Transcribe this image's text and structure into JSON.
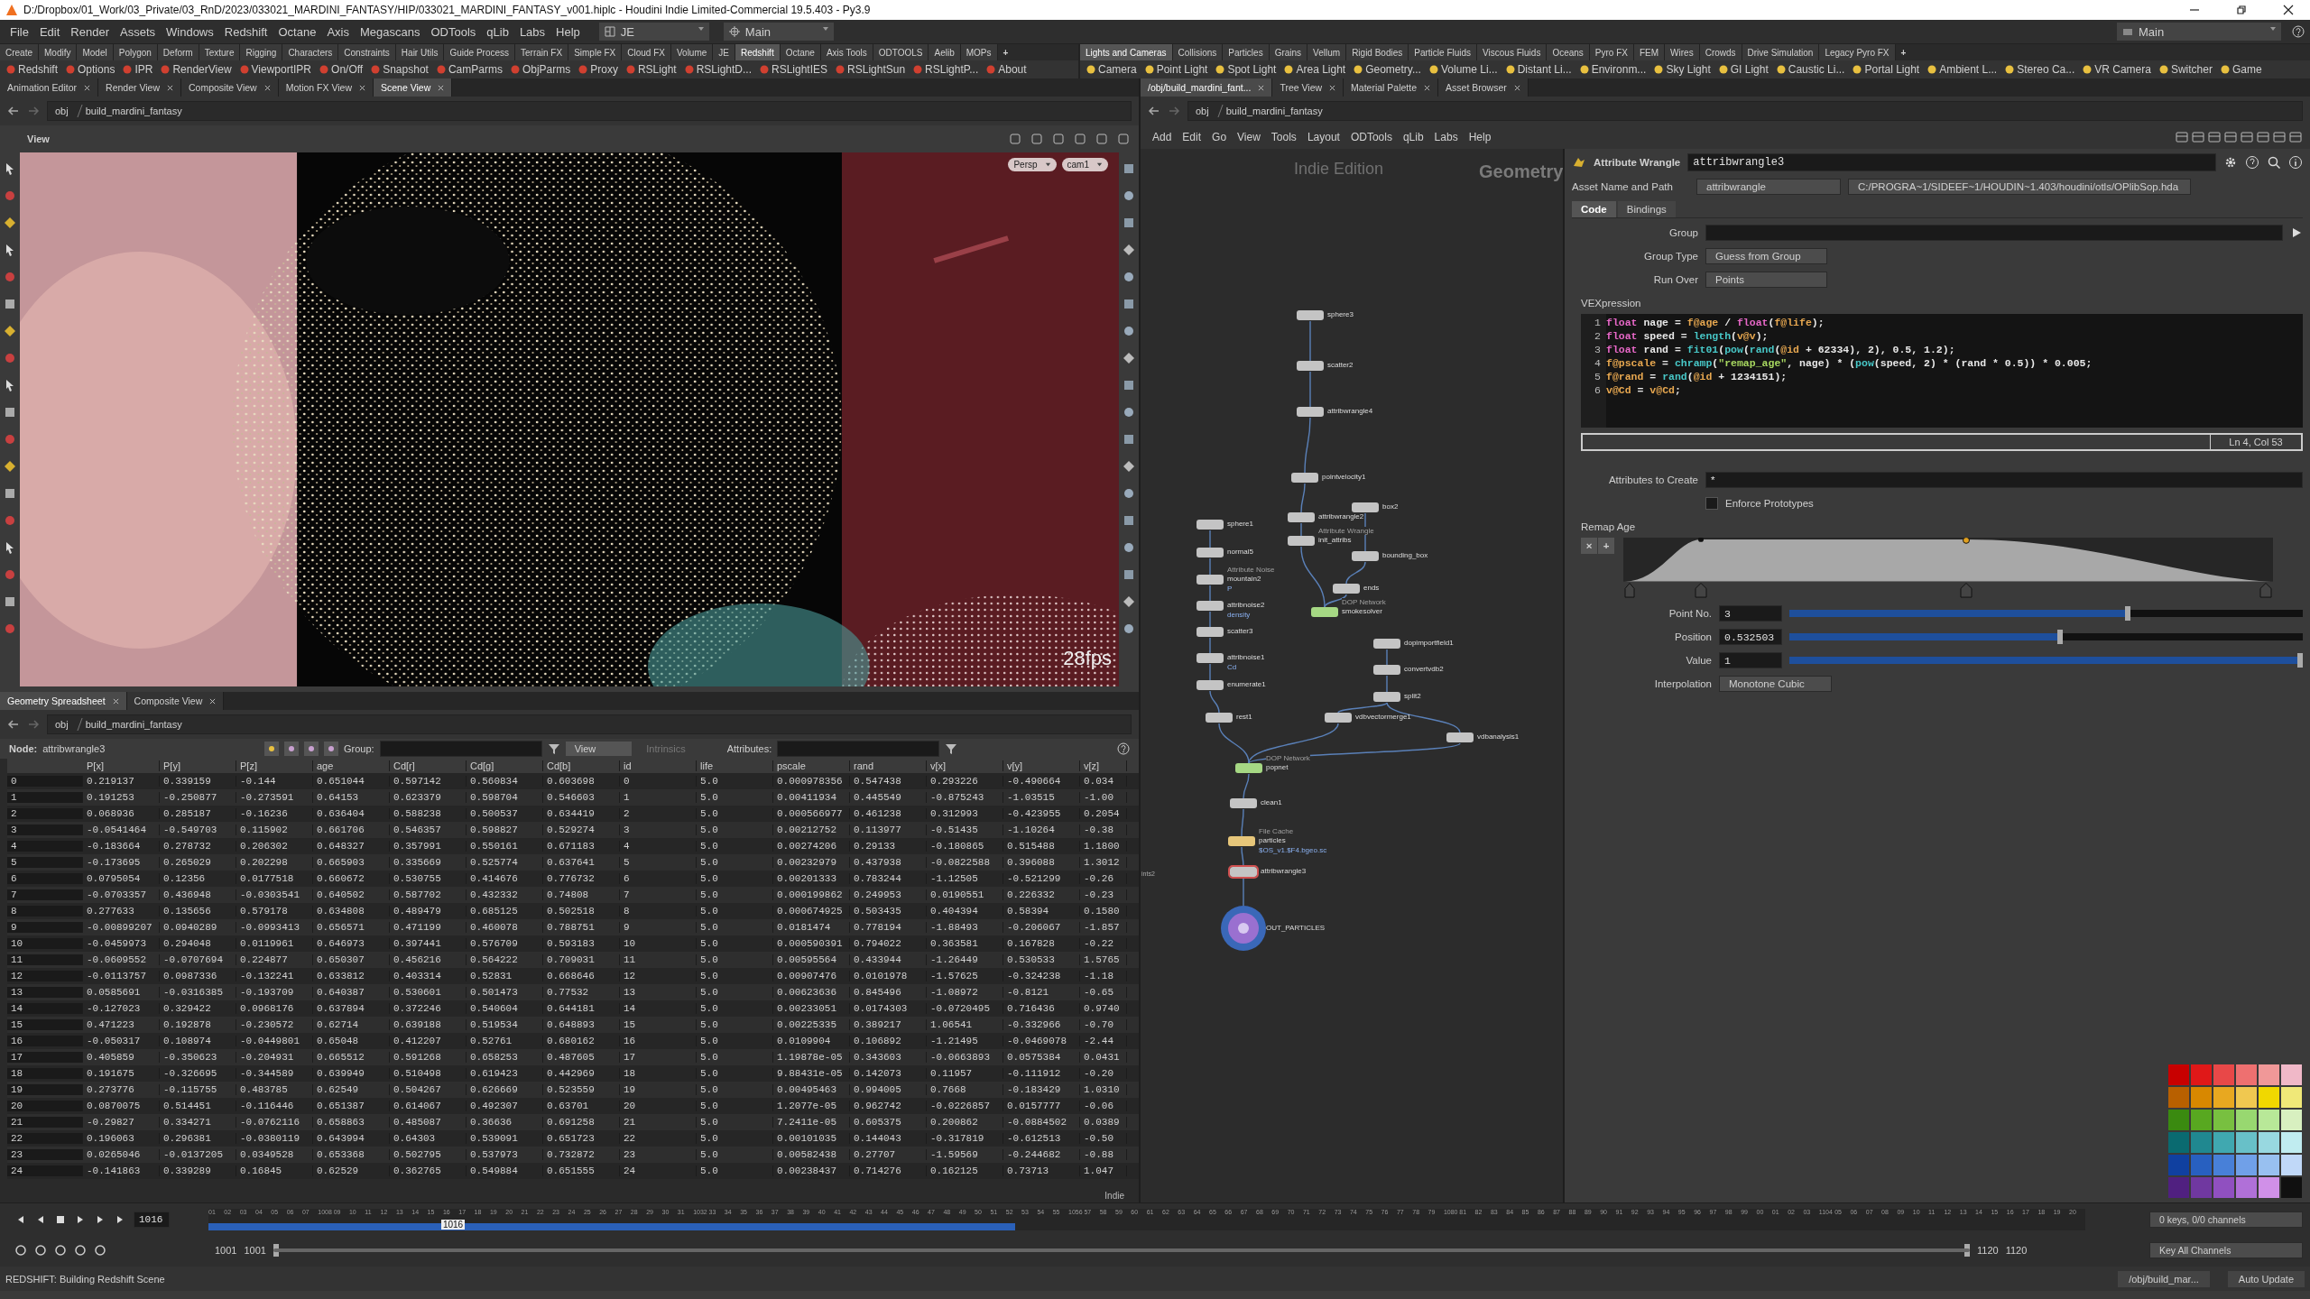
{
  "window": {
    "title": "D:/Dropbox/01_Work/03_Private/03_RnD/2023/033021_MARDINI_FANTASY/HIP/033021_MARDINI_FANTASY_v001.hiplc - Houdini Indie Limited-Commercial 19.5.403 - Py3.9"
  },
  "menu": [
    "File",
    "Edit",
    "Render",
    "Assets",
    "Windows",
    "Redshift",
    "Octane",
    "Axis",
    "Megascans",
    "ODTools",
    "qLib",
    "Labs",
    "Help"
  ],
  "desktop": "JE",
  "context": "Main",
  "desktop_right": "Main",
  "shelf_left": {
    "tabs": [
      {
        "label": "Create",
        "selected": false
      },
      {
        "label": "Modify",
        "selected": false
      },
      {
        "label": "Model",
        "selected": false
      },
      {
        "label": "Polygon",
        "selected": false
      },
      {
        "label": "Deform",
        "selected": false
      },
      {
        "label": "Texture",
        "selected": false
      },
      {
        "label": "Rigging",
        "selected": false
      },
      {
        "label": "Characters",
        "selected": false
      },
      {
        "label": "Constraints",
        "selected": false
      },
      {
        "label": "Hair Utils",
        "selected": false
      },
      {
        "label": "Guide Process",
        "selected": false
      },
      {
        "label": "Terrain FX",
        "selected": false
      },
      {
        "label": "Simple FX",
        "selected": false
      },
      {
        "label": "Cloud FX",
        "selected": false
      },
      {
        "label": "Volume",
        "selected": false
      },
      {
        "label": "JE",
        "selected": false
      },
      {
        "label": "Redshift",
        "selected": true
      },
      {
        "label": "Octane",
        "selected": false
      },
      {
        "label": "Axis Tools",
        "selected": false
      },
      {
        "label": "ODTOOLS",
        "selected": false
      },
      {
        "label": "Aelib",
        "selected": false
      },
      {
        "label": "MOPs",
        "selected": false
      }
    ],
    "add": "+",
    "tools": [
      "Redshift",
      "Options",
      "IPR",
      "RenderView",
      "ViewportIPR",
      "On/Off",
      "Snapshot",
      "CamParms",
      "ObjParms",
      "Proxy",
      "RSLight",
      "RSLightD...",
      "RSLightIES",
      "RSLightSun",
      "RSLightP...",
      "About"
    ]
  },
  "shelf_right": {
    "tabs": [
      {
        "label": "Lights and Cameras",
        "selected": true
      },
      {
        "label": "Collisions",
        "selected": false
      },
      {
        "label": "Particles",
        "selected": false
      },
      {
        "label": "Grains",
        "selected": false
      },
      {
        "label": "Vellum",
        "selected": false
      },
      {
        "label": "Rigid Bodies",
        "selected": false
      },
      {
        "label": "Particle Fluids",
        "selected": false
      },
      {
        "label": "Viscous Fluids",
        "selected": false
      },
      {
        "label": "Oceans",
        "selected": false
      },
      {
        "label": "Pyro FX",
        "selected": false
      },
      {
        "label": "FEM",
        "selected": false
      },
      {
        "label": "Wires",
        "selected": false
      },
      {
        "label": "Crowds",
        "selected": false
      },
      {
        "label": "Drive Simulation",
        "selected": false
      },
      {
        "label": "Legacy Pyro FX",
        "selected": false
      }
    ],
    "add": "+",
    "tools": [
      "Camera",
      "Point Light",
      "Spot Light",
      "Area Light",
      "Geometry...",
      "Volume Li...",
      "Distant Li...",
      "Environm...",
      "Sky Light",
      "GI Light",
      "Caustic Li...",
      "Portal Light",
      "Ambient L...",
      "Stereo Ca...",
      "VR Camera",
      "Switcher",
      "Game"
    ]
  },
  "left_pane": {
    "tabs": [
      {
        "label": "Animation Editor",
        "selected": false
      },
      {
        "label": "Render View",
        "selected": false
      },
      {
        "label": "Composite View",
        "selected": false
      },
      {
        "label": "Motion FX View",
        "selected": false
      },
      {
        "label": "Scene View",
        "selected": true
      }
    ],
    "path": [
      "obj",
      "build_mardini_fantasy"
    ],
    "viewport": {
      "label": "View",
      "menus": [
        "Persp",
        "cam1"
      ],
      "fps": "28fps"
    }
  },
  "spreadsheet_pane": {
    "tabs": [
      {
        "label": "Geometry Spreadsheet",
        "selected": true
      },
      {
        "label": "Composite View",
        "selected": false
      }
    ],
    "path": [
      "obj",
      "build_mardini_fantasy"
    ],
    "node_label": "Node:",
    "node": "attribwrangle3",
    "group_label": "Group:",
    "view": "View",
    "intrinsics": "Intrinsics",
    "attributes_label": "Attributes:",
    "watermark": "Indie",
    "columns": [
      "",
      "P[x]",
      "P[y]",
      "P[z]",
      "age",
      "Cd[r]",
      "Cd[g]",
      "Cd[b]",
      "id",
      "life",
      "pscale",
      "rand",
      "v[x]",
      "v[y]",
      "v[z]"
    ],
    "rows": [
      [
        "0",
        "0.219137",
        "0.339159",
        "-0.144",
        "0.651044",
        "0.597142",
        "0.560834",
        "0.603698",
        "0",
        "5.0",
        "0.000978356",
        "0.547438",
        "0.293226",
        "-0.490664",
        "0.034"
      ],
      [
        "1",
        "0.191253",
        "-0.250877",
        "-0.273591",
        "0.64153",
        "0.623379",
        "0.598704",
        "0.546603",
        "1",
        "5.0",
        "0.00411934",
        "0.445549",
        "-0.875243",
        "-1.03515",
        "-1.00"
      ],
      [
        "2",
        "0.068936",
        "0.285187",
        "-0.16236",
        "0.636404",
        "0.588238",
        "0.500537",
        "0.634419",
        "2",
        "5.0",
        "0.000566977",
        "0.461238",
        "0.312993",
        "-0.423955",
        "0.2054"
      ],
      [
        "3",
        "-0.0541464",
        "-0.549703",
        "0.115902",
        "0.661706",
        "0.546357",
        "0.598827",
        "0.529274",
        "3",
        "5.0",
        "0.00212752",
        "0.113977",
        "-0.51435",
        "-1.10264",
        "-0.38"
      ],
      [
        "4",
        "-0.183664",
        "0.278732",
        "0.206302",
        "0.648327",
        "0.357991",
        "0.550161",
        "0.671183",
        "4",
        "5.0",
        "0.00274206",
        "0.29133",
        "-0.180865",
        "0.515488",
        "1.1800"
      ],
      [
        "5",
        "-0.173695",
        "0.265029",
        "0.202298",
        "0.665903",
        "0.335669",
        "0.525774",
        "0.637641",
        "5",
        "5.0",
        "0.00232979",
        "0.437938",
        "-0.0822588",
        "0.396088",
        "1.3012"
      ],
      [
        "6",
        "0.0795054",
        "0.12356",
        "0.0177518",
        "0.660672",
        "0.530755",
        "0.414676",
        "0.776732",
        "6",
        "5.0",
        "0.00201333",
        "0.783244",
        "-1.12505",
        "-0.521299",
        "-0.26"
      ],
      [
        "7",
        "-0.0703357",
        "0.436948",
        "-0.0303541",
        "0.640502",
        "0.587702",
        "0.432332",
        "0.74808",
        "7",
        "5.0",
        "0.000199862",
        "0.249953",
        "0.0190551",
        "0.226332",
        "-0.23"
      ],
      [
        "8",
        "0.277633",
        "0.135656",
        "0.579178",
        "0.634808",
        "0.489479",
        "0.685125",
        "0.502518",
        "8",
        "5.0",
        "0.000674925",
        "0.503435",
        "0.404394",
        "0.58394",
        "0.1580"
      ],
      [
        "9",
        "-0.00899207",
        "0.0940289",
        "-0.0993413",
        "0.656571",
        "0.471199",
        "0.460078",
        "0.788751",
        "9",
        "5.0",
        "0.0181474",
        "0.778194",
        "-1.88493",
        "-0.206067",
        "-1.857"
      ],
      [
        "10",
        "-0.0459973",
        "0.294048",
        "0.0119961",
        "0.646973",
        "0.397441",
        "0.576709",
        "0.593183",
        "10",
        "5.0",
        "0.000590391",
        "0.794022",
        "0.363581",
        "0.167828",
        "-0.22"
      ],
      [
        "11",
        "-0.0609552",
        "-0.0707694",
        "0.224877",
        "0.650307",
        "0.456216",
        "0.564222",
        "0.709031",
        "11",
        "5.0",
        "0.00595564",
        "0.433944",
        "-1.26449",
        "0.530533",
        "1.5765"
      ],
      [
        "12",
        "-0.0113757",
        "0.0987336",
        "-0.132241",
        "0.633812",
        "0.403314",
        "0.52831",
        "0.668646",
        "12",
        "5.0",
        "0.00907476",
        "0.0101978",
        "-1.57625",
        "-0.324238",
        "-1.18"
      ],
      [
        "13",
        "0.0585691",
        "-0.0316385",
        "-0.193709",
        "0.640387",
        "0.530601",
        "0.501473",
        "0.77532",
        "13",
        "5.0",
        "0.00623636",
        "0.845496",
        "-1.08972",
        "-0.8121",
        "-0.65"
      ],
      [
        "14",
        "-0.127023",
        "0.329422",
        "0.0968176",
        "0.637894",
        "0.372246",
        "0.540604",
        "0.644181",
        "14",
        "5.0",
        "0.00233051",
        "0.0174303",
        "-0.0720495",
        "0.716436",
        "0.9740"
      ],
      [
        "15",
        "0.471223",
        "0.192878",
        "-0.230572",
        "0.62714",
        "0.639188",
        "0.519534",
        "0.648893",
        "15",
        "5.0",
        "0.00225335",
        "0.389217",
        "1.06541",
        "-0.332966",
        "-0.70"
      ],
      [
        "16",
        "-0.050317",
        "0.108974",
        "-0.0449801",
        "0.65048",
        "0.412207",
        "0.52761",
        "0.680162",
        "16",
        "5.0",
        "0.0109904",
        "0.106892",
        "-1.21495",
        "-0.0469078",
        "-2.44"
      ],
      [
        "17",
        "0.405859",
        "-0.350623",
        "-0.204931",
        "0.665512",
        "0.591268",
        "0.658253",
        "0.487605",
        "17",
        "5.0",
        "1.19878e-05",
        "0.343603",
        "-0.0663893",
        "0.0575384",
        "0.0431"
      ],
      [
        "18",
        "0.191675",
        "-0.326695",
        "-0.344589",
        "0.639949",
        "0.510498",
        "0.619423",
        "0.442969",
        "18",
        "5.0",
        "9.88431e-05",
        "0.142073",
        "0.11957",
        "-0.111912",
        "-0.20"
      ],
      [
        "19",
        "0.273776",
        "-0.115755",
        "0.483785",
        "0.62549",
        "0.504267",
        "0.626669",
        "0.523559",
        "19",
        "5.0",
        "0.00495463",
        "0.994005",
        "0.7668",
        "-0.183429",
        "1.0310"
      ],
      [
        "20",
        "0.0870075",
        "0.514451",
        "-0.116446",
        "0.651387",
        "0.614067",
        "0.492307",
        "0.63701",
        "20",
        "5.0",
        "1.2077e-05",
        "0.962742",
        "-0.0226857",
        "0.0157777",
        "-0.06"
      ],
      [
        "21",
        "-0.29827",
        "0.334271",
        "-0.0762116",
        "0.658863",
        "0.485087",
        "0.36636",
        "0.691258",
        "21",
        "5.0",
        "7.2411e-05",
        "0.605375",
        "0.200862",
        "-0.0884502",
        "0.0389"
      ],
      [
        "22",
        "0.196063",
        "0.296381",
        "-0.0380119",
        "0.643994",
        "0.64303",
        "0.539091",
        "0.651723",
        "22",
        "5.0",
        "0.00101035",
        "0.144043",
        "-0.317819",
        "-0.612513",
        "-0.50"
      ],
      [
        "23",
        "0.0265046",
        "-0.0137205",
        "0.0349528",
        "0.653368",
        "0.502795",
        "0.537973",
        "0.732872",
        "23",
        "5.0",
        "0.00582438",
        "0.27707",
        "-1.59569",
        "-0.244682",
        "-0.88"
      ],
      [
        "24",
        "-0.141863",
        "0.339289",
        "0.16845",
        "0.62529",
        "0.362765",
        "0.549884",
        "0.651555",
        "24",
        "5.0",
        "0.00238437",
        "0.714276",
        "0.162125",
        "0.73713",
        "1.047"
      ]
    ]
  },
  "right_pane": {
    "tabs": [
      {
        "label": "/obj/build_mardini_fant...",
        "selected": true
      },
      {
        "label": "Tree View",
        "selected": false
      },
      {
        "label": "Material Palette",
        "selected": false
      },
      {
        "label": "Asset Browser",
        "selected": false
      }
    ],
    "path": [
      "obj",
      "build_mardini_fantasy"
    ],
    "menu": [
      "Add",
      "Edit",
      "Go",
      "View",
      "Tools",
      "Layout",
      "ODTools",
      "qLib",
      "Labs",
      "Help"
    ]
  },
  "network": {
    "edition": "Indie Edition",
    "context": "Geometry",
    "side_label": "ints2",
    "nodes": [
      {
        "name": "sphere3",
        "kind": "sop",
        "selected": false
      },
      {
        "name": "scatter2",
        "kind": "sop",
        "selected": false
      },
      {
        "name": "attribwrangle4",
        "kind": "sop",
        "selected": false
      },
      {
        "name": "pointvelocity1",
        "kind": "sop",
        "selected": false
      },
      {
        "name": "attribwrangle2",
        "kind": "sop",
        "selected": false
      },
      {
        "name": "init_attribs",
        "kind": "sop",
        "type_label": "Attribute Wrangle",
        "selected": false
      },
      {
        "name": "box2",
        "kind": "sop",
        "selected": false
      },
      {
        "name": "bounding_box",
        "kind": "sop",
        "selected": false
      },
      {
        "name": "ends",
        "kind": "sop",
        "selected": false
      },
      {
        "name": "smokesolver",
        "kind": "dop",
        "type_label": "DOP Network",
        "selected": false
      },
      {
        "name": "sphere1",
        "kind": "sop",
        "selected": false
      },
      {
        "name": "normal5",
        "kind": "sop",
        "selected": false
      },
      {
        "name": "mountain2",
        "kind": "sop",
        "type_label": "Attribute Noise",
        "note": "P",
        "selected": false
      },
      {
        "name": "attribnoise2",
        "kind": "sop",
        "note": "density",
        "selected": false
      },
      {
        "name": "scatter3",
        "kind": "sop",
        "selected": false
      },
      {
        "name": "attribnoise1",
        "kind": "sop",
        "note": "Cd",
        "selected": false
      },
      {
        "name": "enumerate1",
        "kind": "sop",
        "selected": false
      },
      {
        "name": "rest1",
        "kind": "sop",
        "selected": false
      },
      {
        "name": "dopimportfield1",
        "kind": "sop",
        "selected": false
      },
      {
        "name": "convertvdb2",
        "kind": "sop",
        "selected": false
      },
      {
        "name": "split2",
        "kind": "sop",
        "selected": false
      },
      {
        "name": "vdbvectormerge1",
        "kind": "sop",
        "selected": false
      },
      {
        "name": "vdbanalysis1",
        "kind": "sop",
        "selected": false
      },
      {
        "name": "popnet",
        "kind": "dop",
        "type_label": "DOP Network",
        "selected": false
      },
      {
        "name": "clean1",
        "kind": "sop",
        "selected": false
      },
      {
        "name": "particles",
        "kind": "cache",
        "type_label": "File Cache",
        "note": "$OS_v1.$F4.bgeo.sc",
        "selected": false
      },
      {
        "name": "attribwrangle3",
        "kind": "sop",
        "selected": true
      },
      {
        "name": "OUT_PARTICLES",
        "kind": "output",
        "selected": false
      }
    ]
  },
  "parameters": {
    "type": "Attribute Wrangle",
    "name": "attribwrangle3",
    "asset_label": "Asset Name and Path",
    "asset": "attribwrangle",
    "asset_path": "C:/PROGRA~1/SIDEEF~1/HOUDIN~1.403/houdini/otls/OPlibSop.hda",
    "tabs": [
      {
        "label": "Code",
        "selected": true
      },
      {
        "label": "Bindings",
        "selected": false
      }
    ],
    "group_label": "Group",
    "group_type_label": "Group Type",
    "group_type": "Guess from Group",
    "run_over_label": "Run Over",
    "run_over": "Points",
    "vex_label": "VEXpression",
    "code": [
      {
        "number": "1",
        "tokens": [
          {
            "kind": "keyword",
            "text": "float"
          },
          {
            "kind": "plain",
            "text": " nage = "
          },
          {
            "kind": "attrib",
            "text": "f@age"
          },
          {
            "kind": "plain",
            "text": " / "
          },
          {
            "kind": "keyword",
            "text": "float"
          },
          {
            "kind": "plain",
            "text": "("
          },
          {
            "kind": "attrib",
            "text": "f@life"
          },
          {
            "kind": "plain",
            "text": ");"
          }
        ]
      },
      {
        "number": "2",
        "tokens": [
          {
            "kind": "keyword",
            "text": "float"
          },
          {
            "kind": "plain",
            "text": " speed = "
          },
          {
            "kind": "function",
            "text": "length"
          },
          {
            "kind": "plain",
            "text": "("
          },
          {
            "kind": "attrib",
            "text": "v@v"
          },
          {
            "kind": "plain",
            "text": ");"
          }
        ]
      },
      {
        "number": "3",
        "tokens": [
          {
            "kind": "keyword",
            "text": "float"
          },
          {
            "kind": "plain",
            "text": " rand = "
          },
          {
            "kind": "function",
            "text": "fit01"
          },
          {
            "kind": "plain",
            "text": "("
          },
          {
            "kind": "function",
            "text": "pow"
          },
          {
            "kind": "plain",
            "text": "("
          },
          {
            "kind": "function",
            "text": "rand"
          },
          {
            "kind": "plain",
            "text": "("
          },
          {
            "kind": "attrib",
            "text": "@id"
          },
          {
            "kind": "plain",
            "text": " + 62334), 2), 0.5, 1.2);"
          }
        ]
      },
      {
        "number": "4",
        "tokens": [
          {
            "kind": "attrib",
            "text": "f@pscale"
          },
          {
            "kind": "plain",
            "text": " = "
          },
          {
            "kind": "function",
            "text": "chramp"
          },
          {
            "kind": "plain",
            "text": "("
          },
          {
            "kind": "string",
            "text": "\"remap_age\""
          },
          {
            "kind": "plain",
            "text": ", nage) * ("
          },
          {
            "kind": "function",
            "text": "pow"
          },
          {
            "kind": "plain",
            "text": "(speed, 2) * (rand * 0.5)) * 0.005;"
          }
        ]
      },
      {
        "number": "5",
        "tokens": [
          {
            "kind": "attrib",
            "text": "f@rand"
          },
          {
            "kind": "plain",
            "text": " = "
          },
          {
            "kind": "function",
            "text": "rand"
          },
          {
            "kind": "plain",
            "text": "("
          },
          {
            "kind": "attrib",
            "text": "@id"
          },
          {
            "kind": "plain",
            "text": " + 1234151);"
          }
        ]
      },
      {
        "number": "6",
        "tokens": [
          {
            "kind": "attrib",
            "text": "v@Cd"
          },
          {
            "kind": "plain",
            "text": " = "
          },
          {
            "kind": "attrib",
            "text": "v@Cd"
          },
          {
            "kind": "plain",
            "text": ";"
          }
        ]
      }
    ],
    "cursor": "Ln 4, Col 53",
    "attributes_label": "Attributes to Create",
    "attributes": "*",
    "enforce": {
      "label": "Enforce Prototypes",
      "checked": false
    },
    "ramp_label": "Remap Age",
    "ramp_buttons": [
      "×",
      "+"
    ],
    "sliders": [
      {
        "label": "Point No.",
        "value": "3",
        "level": 0.665
      },
      {
        "label": "Position",
        "value": "0.532503",
        "level": 0.532
      },
      {
        "label": "Value",
        "value": "1",
        "level": 1
      }
    ],
    "interp_label": "Interpolation",
    "interp": "Monotone Cubic"
  },
  "timeline": {
    "frame": "1016",
    "playhead": {
      "label": "1016",
      "level": 0.124
    },
    "cache": {
      "level": 0.43
    },
    "ruler": [
      "01",
      "02",
      "03",
      "04",
      "05",
      "06",
      "07",
      "1008",
      "09",
      "10",
      "11",
      "12",
      "13",
      "14",
      "15",
      "16",
      "17",
      "18",
      "19",
      "20",
      "21",
      "22",
      "23",
      "24",
      "25",
      "26",
      "27",
      "28",
      "29",
      "30",
      "31",
      "1032",
      "33",
      "34",
      "35",
      "36",
      "37",
      "38",
      "39",
      "40",
      "41",
      "42",
      "43",
      "44",
      "45",
      "46",
      "47",
      "48",
      "49",
      "50",
      "51",
      "52",
      "53",
      "54",
      "55",
      "1056",
      "57",
      "58",
      "59",
      "60",
      "61",
      "62",
      "63",
      "64",
      "65",
      "66",
      "67",
      "68",
      "69",
      "70",
      "71",
      "72",
      "73",
      "74",
      "75",
      "76",
      "77",
      "78",
      "79",
      "1080",
      "81",
      "82",
      "83",
      "84",
      "85",
      "86",
      "87",
      "88",
      "89",
      "90",
      "91",
      "92",
      "93",
      "94",
      "95",
      "96",
      "97",
      "98",
      "99",
      "00",
      "01",
      "02",
      "03",
      "1104",
      "05",
      "06",
      "07",
      "08",
      "09",
      "10",
      "11",
      "12",
      "13",
      "14",
      "15",
      "16",
      "17",
      "18",
      "19",
      "20"
    ],
    "range": [
      "1001",
      "1001",
      "1120",
      "1120"
    ],
    "range_bar": {
      "level": 1
    },
    "keys": "0 keys, 0/0 channels",
    "key_all": "Key All Channels"
  },
  "status": {
    "message": "REDSHIFT: Building Redshift Scene",
    "path": "/obj/build_mar...",
    "update": "Auto Update"
  }
}
